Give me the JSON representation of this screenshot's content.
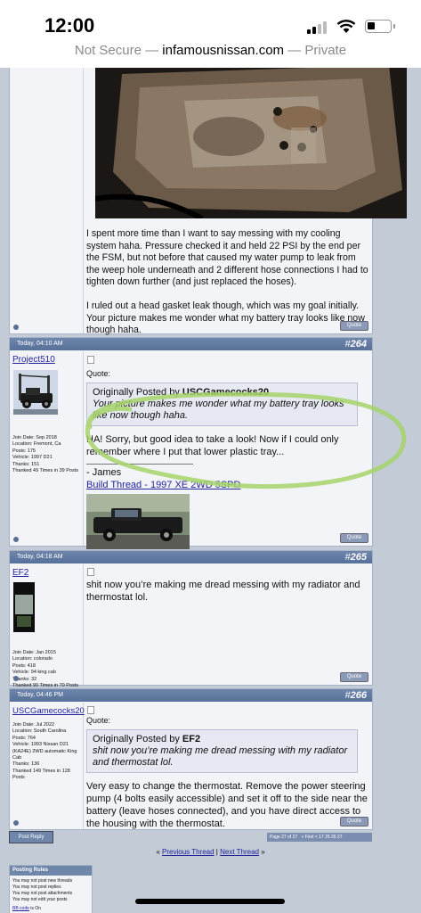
{
  "status_bar": {
    "time": "12:00"
  },
  "browser": {
    "prefix": "Not Secure — ",
    "host": "infamousnissan.com",
    "suffix": " — Private"
  },
  "post263": {
    "text1": "I spent more time than I want to say messing with my cooling system haha. Pressure checked it and held 22 PSI by the end per the FSM, but not before that caused my water pump to leak from the weep hole underneath and 2 different hose connections I had to tighten down further (and just replaced the hoses).",
    "text2": "I ruled out a head gasket leak though, which was my goal initially. Your picture makes me wonder what my battery tray looks like now though haha.",
    "quote_btn": "Quote"
  },
  "post264": {
    "date": "Today, 04:10 AM",
    "num_prefix": "#",
    "number": "264",
    "username": "Project510",
    "info": [
      "Join Date: Sep 2018",
      "Location: Fremont, Ca",
      "Posts: 175",
      "Vehicle: 1997 D21",
      "Thanks: 151",
      "Thanked 49 Times in 39 Posts"
    ],
    "quote_label": "Quote:",
    "quote_from_prefix": "Originally Posted by ",
    "quote_from": "USCGamecocks20",
    "quote_text": "Your picture makes me wonder what my battery tray looks like now though haha.",
    "text": "HA! Sorry, but good idea to take a look! Now if I could only remember where I put that lower plastic tray...",
    "sig_name": "- James",
    "sig_link": "Build Thread - 1997 XE 2WD 5SPD",
    "quote_btn": "Quote"
  },
  "post265": {
    "date": "Today, 04:18 AM",
    "num_prefix": "#",
    "number": "265",
    "username": "EF2",
    "info": [
      "Join Date: Jan 2015",
      "Location: colorado",
      "Posts: 418",
      "Vehicle: 94 king cab",
      "Thanks: 32",
      "Thanked 90 Times in 70 Posts"
    ],
    "text": "shit now you’re making me dread messing with my radiator and thermostat lol.",
    "quote_btn": "Quote"
  },
  "post266": {
    "date": "Today, 04:46 PM",
    "num_prefix": "#",
    "number": "266",
    "username": "USCGamecocks20",
    "info": [
      "Join Date: Jul 2022",
      "Location: South Carolina",
      "Posts: 764",
      "Vehicle: 1993 Nissan D21",
      "(KA24E) 2WD automatic King",
      "Cab",
      "Thanks: 136",
      "Thanked 149 Times in 128",
      "Posts"
    ],
    "quote_label": "Quote:",
    "quote_from_prefix": "Originally Posted by ",
    "quote_from": "EF2",
    "quote_text": "shit now you’re making me dread messing with my radiator and thermostat lol.",
    "text": "Very easy to change the thermostat. Remove the power steering pump (4 bolts easily accessible) and set it off to the side near the battery (leave hoses connected), and you have direct access to the housing with the thermostat.",
    "quote_btn": "Quote"
  },
  "footer": {
    "post_reply": "Post Reply",
    "page_of": "Page 27 of 27",
    "pager_links": "« First  <  17  25  26  27",
    "prev_thread": "Previous Thread",
    "next_thread": "Next Thread",
    "nav_sep": " | ",
    "nav_left": "« ",
    "nav_right": " »"
  },
  "posting_rules": {
    "title": "Posting Rules",
    "lines": [
      "You may not post new threads",
      "You may not post replies",
      "You may not post attachments",
      "You may not edit your posts"
    ],
    "bb_code_link": "BB code",
    "bb_code_rest": " is On"
  },
  "colors": {
    "header": "#5f789f",
    "highlight_scribble": "#a6d46a",
    "link": "#22229c"
  }
}
